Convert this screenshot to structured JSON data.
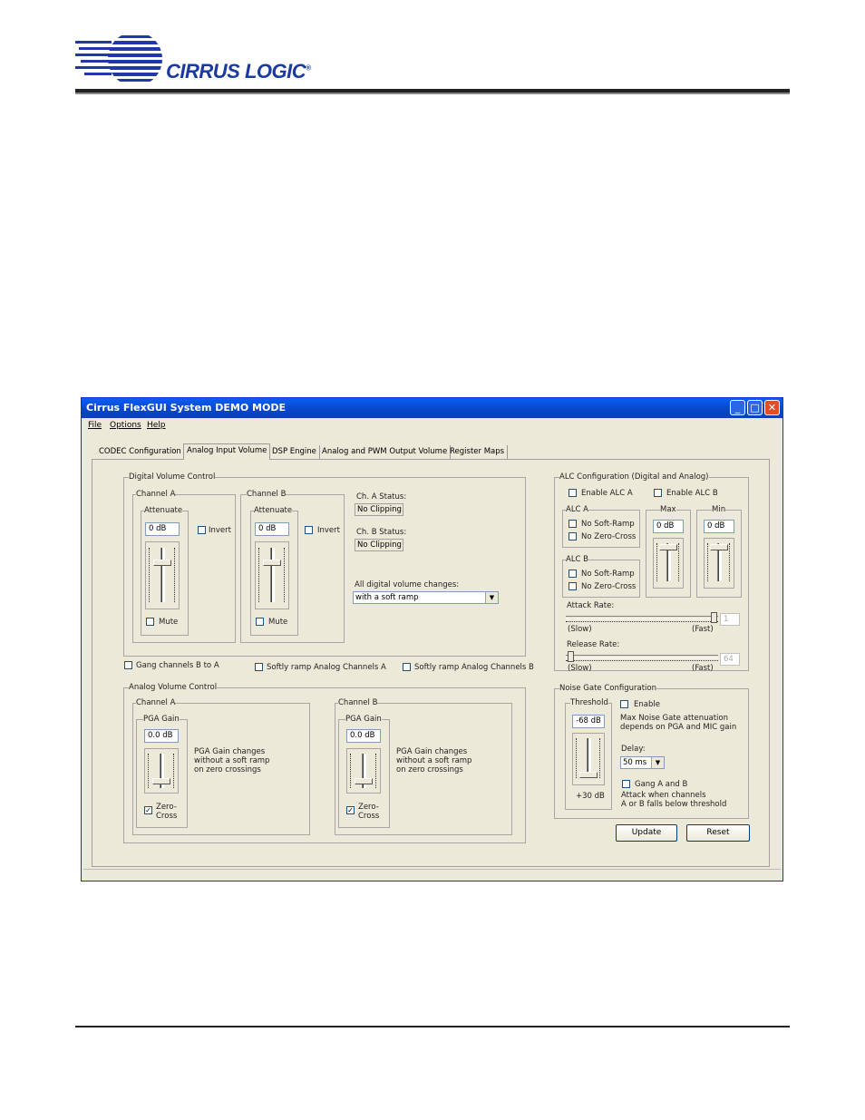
{
  "header": {
    "brand": "CIRRUS LOGIC",
    "registered": "®",
    "logo_icon": "cirrus-logic-logo-icon"
  },
  "window": {
    "title": "Cirrus FlexGUI System DEMO MODE",
    "controls": [
      "minimize-icon",
      "maximize-icon",
      "close-icon"
    ],
    "menu": [
      "File",
      "Options",
      "Help"
    ],
    "tabs": [
      "CODEC Configuration",
      "Analog Input Volume",
      "DSP Engine",
      "Analog and PWM Output Volume",
      "Register Maps"
    ],
    "active_tab": "Analog Input Volume"
  },
  "digital_volume": {
    "title": "Digital Volume Control",
    "channel_a": {
      "title": "Channel A",
      "attenuate_title": "Attenuate",
      "value": "0 dB",
      "invert_label": "Invert",
      "mute_label": "Mute"
    },
    "channel_b": {
      "title": "Channel B",
      "attenuate_title": "Attenuate",
      "value": "0 dB",
      "invert_label": "Invert",
      "mute_label": "Mute"
    },
    "ch_a_status_label": "Ch. A Status:",
    "ch_a_status": "No Clipping",
    "ch_b_status_label": "Ch. B Status:",
    "ch_b_status": "No Clipping",
    "changes_label": "All digital volume changes:",
    "changes_value": "with a soft ramp"
  },
  "gang_label": "Gang channels B to A",
  "soft_ramp_a": "Softly ramp Analog Channels A",
  "soft_ramp_b": "Softly ramp Analog Channels B",
  "analog_volume": {
    "title": "Analog Volume Control",
    "channel_a": {
      "title": "Channel A",
      "pga_title": "PGA Gain",
      "value": "0.0 dB",
      "zero_cross": "Zero-\nCross",
      "note": "PGA Gain changes\nwithout a soft ramp\non zero crossings"
    },
    "channel_b": {
      "title": "Channel B",
      "pga_title": "PGA Gain",
      "value": "0.0 dB",
      "zero_cross": "Zero-\nCross",
      "note": "PGA Gain changes\nwithout a soft ramp\non zero crossings"
    }
  },
  "alc": {
    "title": "ALC Configuration (Digital and Analog)",
    "enable_a": "Enable ALC A",
    "enable_b": "Enable ALC B",
    "alc_a": {
      "title": "ALC A",
      "no_soft": "No Soft-Ramp",
      "no_zero": "No Zero-Cross"
    },
    "alc_b": {
      "title": "ALC B",
      "no_soft": "No Soft-Ramp",
      "no_zero": "No Zero-Cross"
    },
    "max_title": "Max",
    "max_value": "0 dB",
    "min_title": "Min",
    "min_value": "0 dB",
    "attack_label": "Attack Rate:",
    "attack_slow": "(Slow)",
    "attack_fast": "(Fast)",
    "attack_value": "1",
    "release_label": "Release Rate:",
    "release_slow": "(Slow)",
    "release_fast": "(Fast)",
    "release_value": "64"
  },
  "noise_gate": {
    "title": "Noise Gate Configuration",
    "threshold_title": "Threshold",
    "threshold_value": "-68 dB",
    "threshold_bottom": "+30 dB",
    "enable_label": "Enable",
    "note": "Max Noise Gate attenuation\ndepends on PGA and MIC gain",
    "delay_label": "Delay:",
    "delay_value": "50 ms",
    "gang_label": "Gang A and B",
    "attack_note": "Attack when channels\nA or B falls below threshold"
  },
  "buttons": {
    "update": "Update",
    "reset": "Reset"
  },
  "checked": {
    "zero_cross_a": "✓",
    "zero_cross_b": "✓"
  }
}
